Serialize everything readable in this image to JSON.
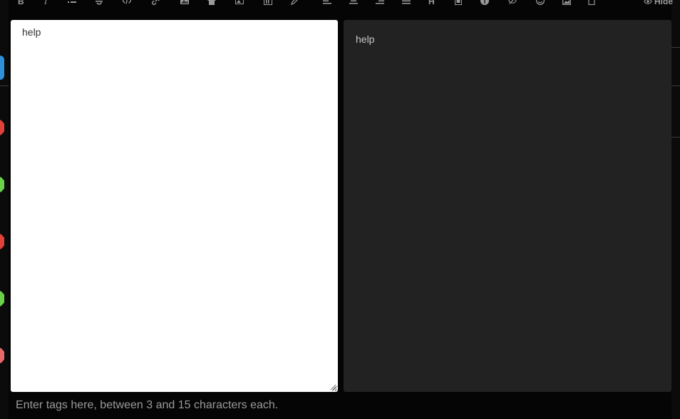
{
  "toolbar": {
    "tools": [
      {
        "icon": "bold-icon",
        "glyph": "B"
      },
      {
        "icon": "italic-icon",
        "glyph": "I"
      },
      {
        "icon": "list-icon"
      },
      {
        "icon": "strikethrough-icon"
      },
      {
        "icon": "code-icon"
      },
      {
        "icon": "link-icon"
      },
      {
        "icon": "image-icon"
      },
      {
        "icon": "home-icon"
      },
      {
        "icon": "media-icon"
      },
      {
        "icon": "chart-icon"
      },
      {
        "icon": "pencil-icon"
      },
      {
        "icon": "align-left-icon"
      },
      {
        "icon": "align-center-icon"
      },
      {
        "icon": "align-right-icon"
      },
      {
        "icon": "align-justify-icon"
      },
      {
        "icon": "heading-icon",
        "glyph": "H"
      },
      {
        "icon": "table-icon"
      },
      {
        "icon": "info-icon"
      },
      {
        "icon": "eye-off-icon"
      },
      {
        "icon": "emoji-icon"
      },
      {
        "icon": "picture-icon"
      },
      {
        "icon": "clipboard-icon"
      }
    ],
    "hide_label": "Hide"
  },
  "editor": {
    "value": "help"
  },
  "preview": {
    "text": "help"
  },
  "tags": {
    "placeholder": "Enter tags here, between 3 and 15 characters each."
  },
  "colors": {
    "background": "#050505",
    "editor_bg": "#ffffff",
    "preview_bg": "#222222",
    "accent_blue": "#3fa0e6"
  }
}
